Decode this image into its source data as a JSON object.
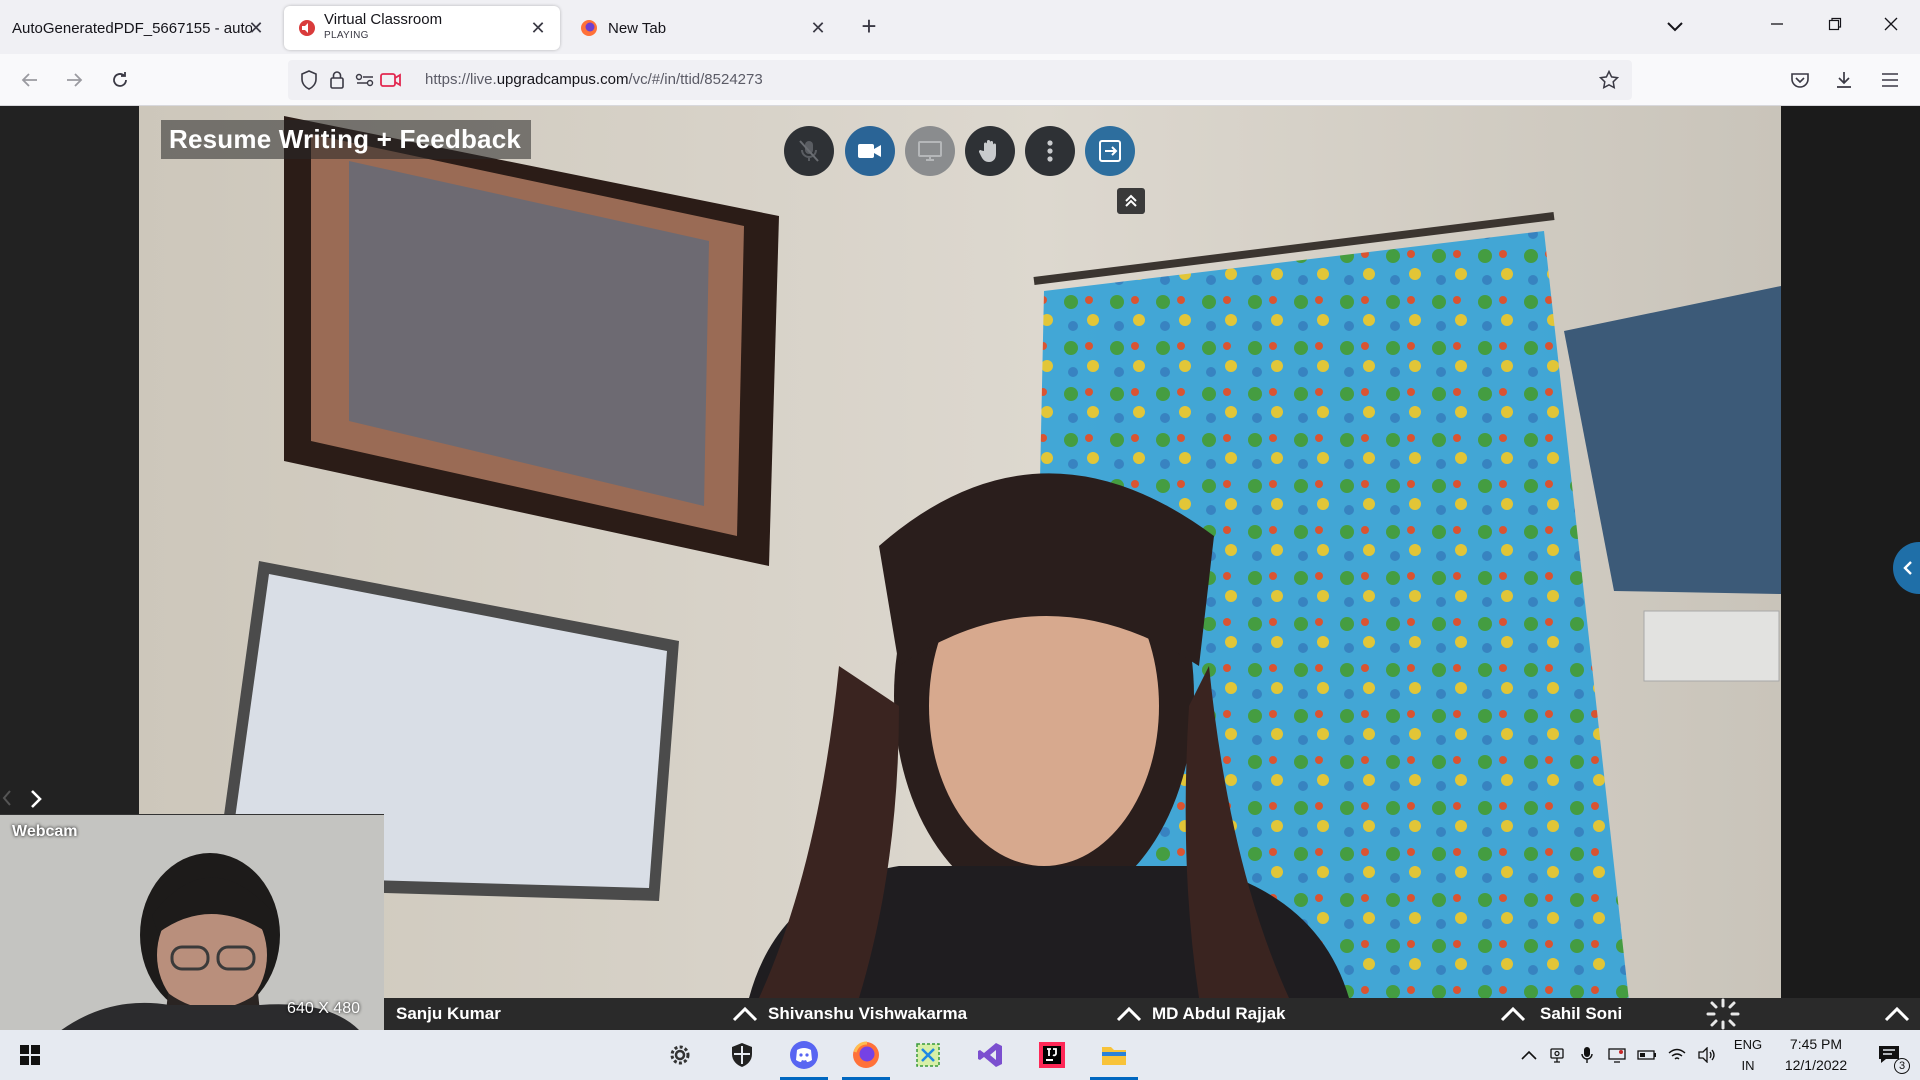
{
  "browser": {
    "tabs": [
      {
        "title": "AutoGeneratedPDF_5667155 - auto",
        "status": ""
      },
      {
        "title": "Virtual Classroom",
        "status": "PLAYING"
      },
      {
        "title": "New Tab",
        "status": ""
      }
    ],
    "url_prefix": "https://live.",
    "url_domain": "upgradcampus.com",
    "url_path": "/vc/#/in/ttid/8524273"
  },
  "classroom": {
    "session_title": "Resume Writing + Feedback",
    "controls": [
      "mic-muted-icon",
      "camera-icon",
      "screen-share-icon",
      "raise-hand-icon",
      "more-options-icon",
      "exit-icon"
    ],
    "webcam": {
      "label": "Webcam",
      "resolution": "640 X 480"
    },
    "participants": [
      "Sanju Kumar",
      "Shivanshu Vishwakarma",
      "MD Abdul Rajjak",
      "Sahil Soni"
    ]
  },
  "taskbar": {
    "apps": [
      "settings-icon",
      "security-icon",
      "discord-icon",
      "firefox-icon",
      "snipping-tool-icon",
      "visual-studio-icon",
      "intellij-icon",
      "file-explorer-icon"
    ],
    "language": {
      "line1": "ENG",
      "line2": "IN"
    },
    "time": "7:45 PM",
    "date": "12/1/2022",
    "notification_count": "3"
  },
  "colors": {
    "accent": "#2a6496",
    "taskbar_active": "#0067c0",
    "side_toggle": "#1f6fa8"
  }
}
